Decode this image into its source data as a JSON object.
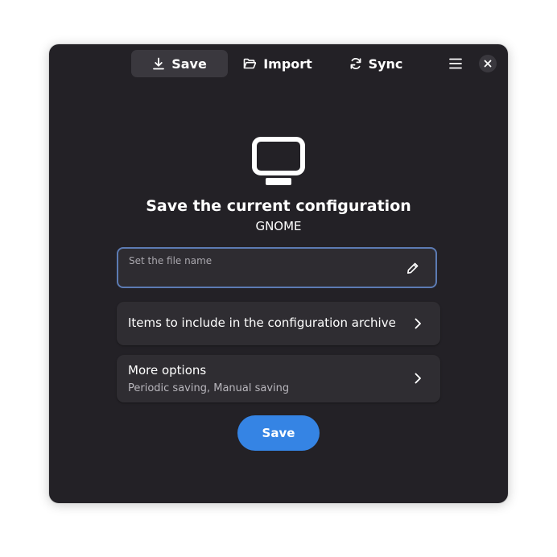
{
  "header": {
    "tabs": [
      {
        "label": "Save",
        "icon": "download-icon",
        "active": true
      },
      {
        "label": "Import",
        "icon": "folder-open-icon",
        "active": false
      },
      {
        "label": "Sync",
        "icon": "sync-icon",
        "active": false
      }
    ],
    "menu_icon": "hamburger-menu-icon",
    "close_icon": "close-icon"
  },
  "main": {
    "hero_icon": "computer-monitor-icon",
    "title": "Save the current configuration",
    "subtitle": "GNOME",
    "file_name_field": {
      "placeholder": "Set the file name",
      "value": "",
      "icon": "pencil-icon"
    },
    "rows": [
      {
        "title": "Items to include in the configuration archive",
        "icon": "chevron-right-icon"
      },
      {
        "title": "More options",
        "subtitle": "Periodic saving, Manual saving",
        "icon": "chevron-right-icon"
      }
    ],
    "save_button": "Save"
  },
  "colors": {
    "window_bg": "#232126",
    "row_bg": "#2f2d32",
    "accent": "#3584e4",
    "focus_border": "#5c7bb3"
  }
}
